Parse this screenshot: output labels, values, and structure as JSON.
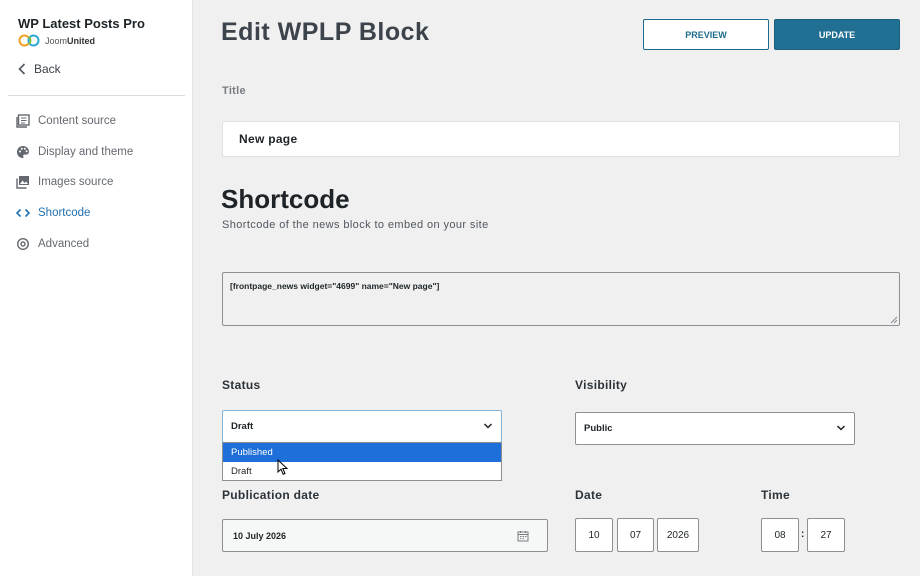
{
  "sidebar": {
    "brand_title": "WP Latest Posts Pro",
    "brand_logo_prefix": "Joom",
    "brand_logo_suffix": "United",
    "back_label": "Back",
    "items": [
      {
        "label": "Content source",
        "icon": "content-source-icon"
      },
      {
        "label": "Display and theme",
        "icon": "palette-icon"
      },
      {
        "label": "Images source",
        "icon": "images-icon"
      },
      {
        "label": "Shortcode",
        "icon": "code-icon",
        "active": true
      },
      {
        "label": "Advanced",
        "icon": "gear-icon"
      }
    ]
  },
  "header": {
    "title": "Edit WPLP Block",
    "preview_label": "PREVIEW",
    "update_label": "UPDATE"
  },
  "title_field": {
    "label": "Title",
    "value": "New page"
  },
  "shortcode": {
    "heading": "Shortcode",
    "subtitle": "Shortcode of the news block to embed on your site",
    "value": "[frontpage_news widget=\"4699\" name=\"New page\"]"
  },
  "status": {
    "label": "Status",
    "selected": "Draft",
    "options": [
      "Published",
      "Draft"
    ],
    "highlighted": "Published"
  },
  "visibility": {
    "label": "Visibility",
    "selected": "Public"
  },
  "publication": {
    "label": "Publication date",
    "value": "10 July 2026"
  },
  "date": {
    "label": "Date",
    "day": "10",
    "month": "07",
    "year": "2026"
  },
  "time": {
    "label": "Time",
    "hour": "08",
    "minute": "27",
    "separator": ":"
  },
  "colors": {
    "accent": "#216f92",
    "active_nav": "#2271b1",
    "dropdown_highlight": "#1e6fd9"
  }
}
